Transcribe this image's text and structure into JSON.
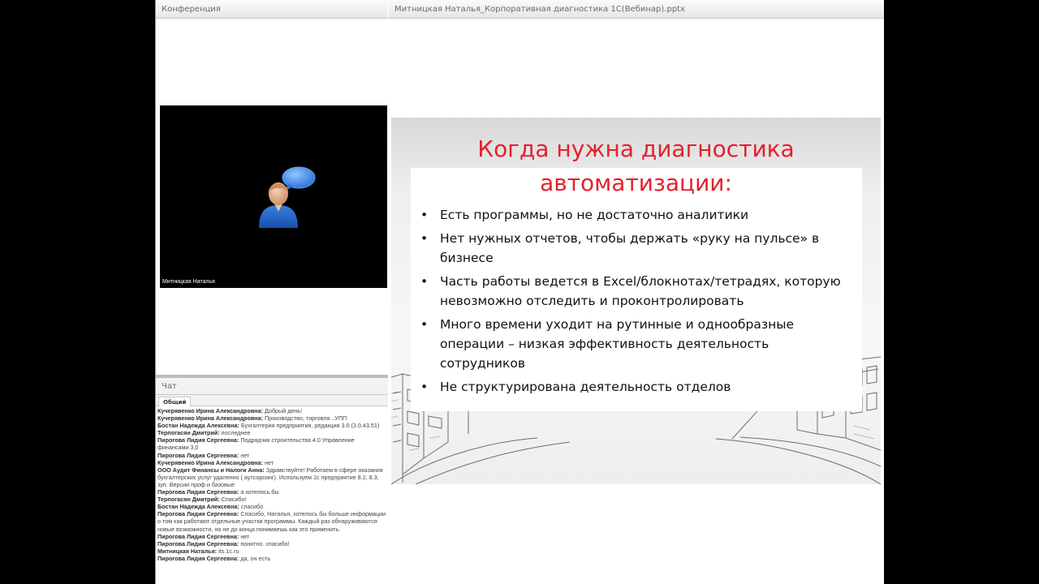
{
  "conference": {
    "title": "Конференция",
    "speaker_name": "Митницкая Наталья"
  },
  "document": {
    "title": "Митницкая Наталья_Корпоративная диагностика 1С(Вебинар).pptx"
  },
  "chat": {
    "title": "Чат",
    "tab_label": "Общий",
    "messages": [
      {
        "author": "Кучерявенко Ирина Александровна:",
        "text": " Добрый день!"
      },
      {
        "author": "Кучерявенко Ирина Александровна:",
        "text": " Производство, торговля ..УПП"
      },
      {
        "author": "Бостан Надежда Алексевна:",
        "text": " Бухгалтерия предприятия, редакция 3.0 (3.0.43.51)"
      },
      {
        "author": "Терпогасян Дмитрий:",
        "text": " последнее"
      },
      {
        "author": "Пирогова Лидия Сергеевна:",
        "text": " Подрядчик строительства 4.0 Управление финансами 3,0"
      },
      {
        "author": "Пирогова Лидия Сергеевна:",
        "text": " нет"
      },
      {
        "author": "Кучерявенко Ирина Александровна:",
        "text": " нет"
      },
      {
        "author": "ООО Аудит Финансы и Налоги Анна:",
        "text": " Здравствуйте! Работаем в сфере оказания бухгалтерских услуг удаленно ( аутсорсинг). Используем 1с предприятие 8.2, 8.3, зуп. Версии проф и базовые"
      },
      {
        "author": "Пирогова Лидия Сергеевна:",
        "text": " а хотелось бы"
      },
      {
        "author": "Терпогасян Дмитрий:",
        "text": " Спасибо!"
      },
      {
        "author": "Бостан Надежда Алексевна:",
        "text": " спасибо"
      },
      {
        "author": "Пирогова Лидия Сергеевна:",
        "text": " Спасибо, Наталья, хотелось бы больше информации о том как работают отдельные участки программы. Каждый раз обнаруживаются новые возможности, но не до конца понимаешь как это применить."
      },
      {
        "author": "Пирогова Лидия Сергеевна:",
        "text": " нет"
      },
      {
        "author": "Пирогова Лидия Сергеевна:",
        "text": " понятно. спасибо!"
      },
      {
        "author": "Митницкая Наталья:",
        "text": " its.1c.ru"
      },
      {
        "author": "Пирогова Лидия Сергеевна:",
        "text": " да, он есть"
      }
    ]
  },
  "slide": {
    "title_line1": "Когда нужна диагностика",
    "title_line2": "автоматизации:",
    "bullets": [
      "Есть программы, но не достаточно аналитики",
      "Нет нужных отчетов, чтобы держать «руку на пульсе» в бизнесе",
      "Часть работы ведется в Excel/блокнотах/тетрадях, которую невозможно отследить и проконтролировать",
      "Много времени уходит на рутинные и однообразные операции – низкая эффективность деятельность сотрудников",
      "Не структурирована деятельность отделов"
    ],
    "title_color": "#e5202a"
  },
  "icons": {
    "avatar": "user-speech-bubble-icon"
  }
}
